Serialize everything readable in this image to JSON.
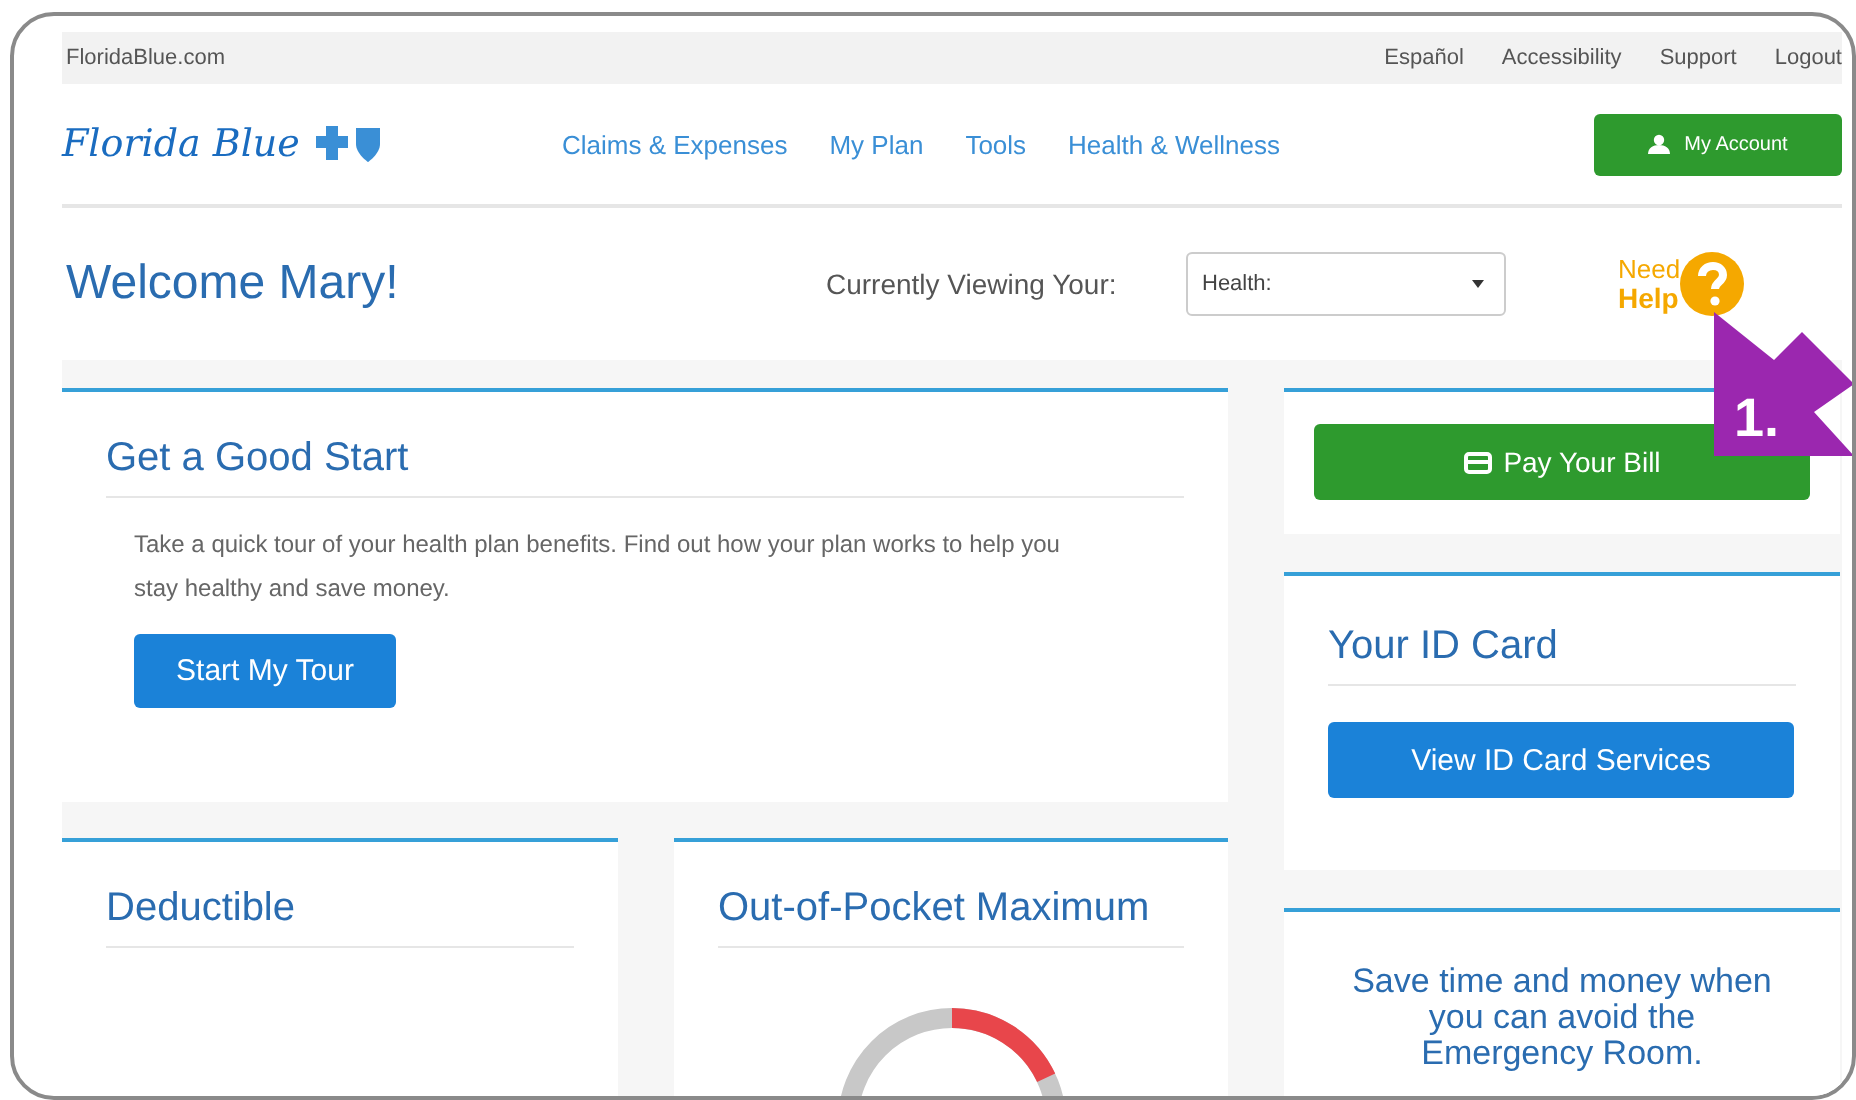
{
  "top_bar": {
    "site": "FloridaBlue.com",
    "links": [
      "Español",
      "Accessibility",
      "Support",
      "Logout"
    ]
  },
  "header": {
    "logo": "Florida Blue",
    "nav": [
      "Claims & Expenses",
      "My Plan",
      "Tools",
      "Health & Wellness"
    ],
    "account_button": "My Account"
  },
  "welcome": {
    "title": "Welcome Mary!",
    "viewing_label": "Currently Viewing Your:",
    "plan_select": "Health:",
    "help": [
      "Need",
      "Help"
    ]
  },
  "good_start": {
    "title": "Get a Good Start",
    "text": "Take a quick tour of your health plan benefits. Find out how your plan works to help you stay healthy and save money.",
    "button": "Start My Tour"
  },
  "deductible": {
    "title": "Deductible"
  },
  "out_of_pocket": {
    "title": "Out-of-Pocket Maximum",
    "level": 0.18
  },
  "pay_bill": {
    "button": "Pay Your Bill"
  },
  "id_card": {
    "title": "Your ID Card",
    "button": "View ID Card Services"
  },
  "emergency": {
    "text": "Save time and money when you can avoid the Emergency Room."
  },
  "callout": {
    "label": "1."
  }
}
